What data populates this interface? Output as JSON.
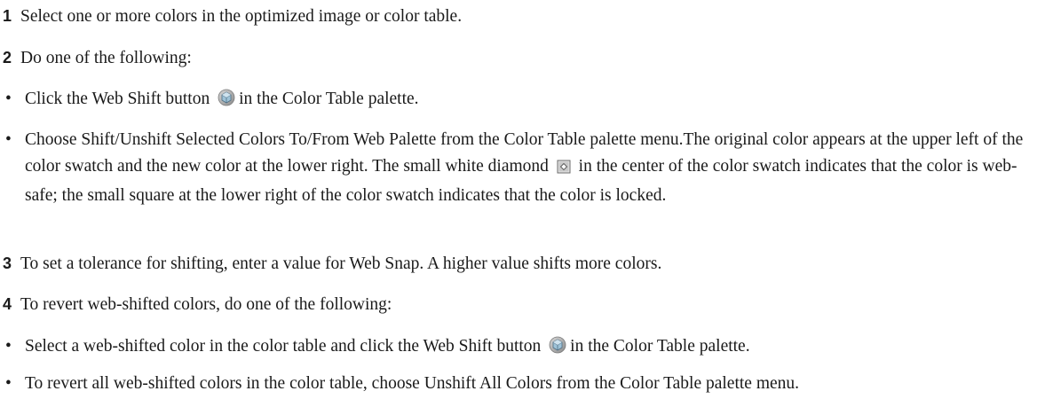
{
  "steps": [
    {
      "number": "1",
      "text": "Select one or more colors in the optimized image or color table."
    },
    {
      "number": "2",
      "text": "Do one of the following:"
    },
    {
      "number": "3",
      "text": "To set a tolerance for shifting, enter a value for Web Snap. A higher value shifts more colors."
    },
    {
      "number": "4",
      "text": "To revert web-shifted colors, do one of the following:"
    }
  ],
  "bullet_char": "•",
  "bullets": {
    "b1_before": "Click the Web Shift button",
    "b1_after": "in the Color Table palette.",
    "b2_before": "Choose Shift/Unshift Selected Colors To/From Web Palette from the Color Table palette menu.The original color appears at the upper left of the color swatch and the new color at the lower right. The small white diamond",
    "b2_after": "in the center of the color swatch indicates that the color is web-safe; the small square at the lower right of the color swatch indicates that the color is locked.",
    "b3_before": "Select a web-shifted color in the color table and click the Web Shift button",
    "b3_after": "in the Color Table palette.",
    "b4": "To revert all web-shifted colors in the color table, choose Unshift All Colors from the Color Table palette menu."
  },
  "icons": {
    "web_shift": "web-shift-cube-icon",
    "web_safe": "web-safe-diamond-icon"
  }
}
